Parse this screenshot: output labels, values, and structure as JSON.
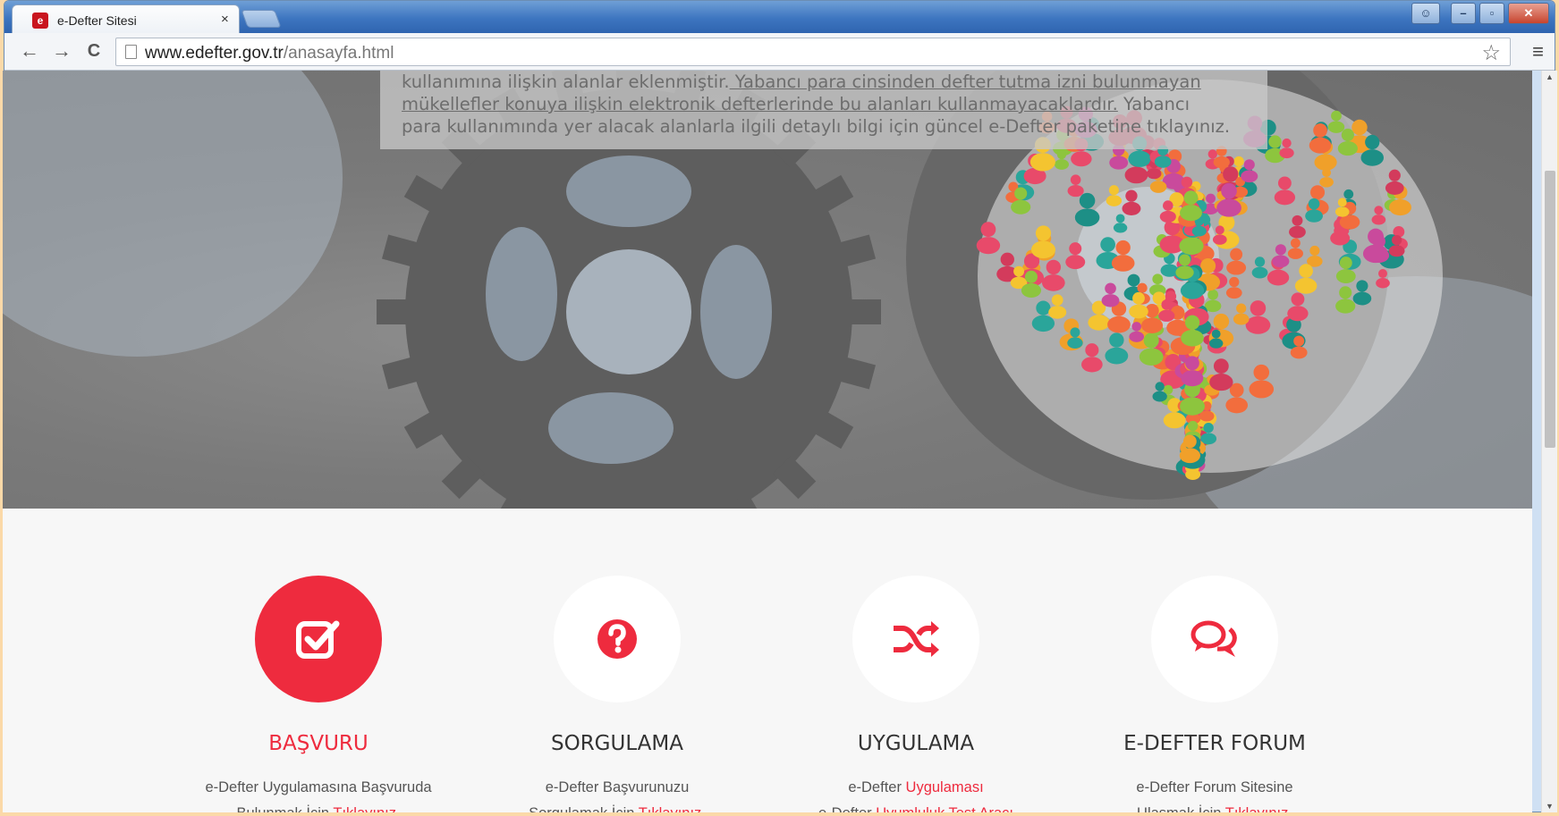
{
  "browser": {
    "tab_title": "e-Defter Sitesi",
    "tab_close": "×",
    "favicon_text": "e",
    "url_domain": "www.edefter.gov.tr",
    "url_path": "/anasayfa.html",
    "back": "←",
    "forward": "→",
    "reload": "C",
    "star": "☆",
    "menu": "≡",
    "win_min": "–",
    "win_max": "▫",
    "win_close": "✕",
    "win_user": "☺"
  },
  "notice": {
    "line1_plain": "kullanımına ilişkin alanlar eklenmiştir.",
    "line1_underlined": " Yabancı para cinsinden defter tutma izni bulunmayan",
    "line2_underlined": "mükellefler konuya ilişkin elektronik defterlerinde bu alanları kullanmayacaklardır.",
    "line2_plain": " Yabancı",
    "line3": "para kullanımında yer alacak alanlarla ilgili detaylı bilgi için güncel e-Defter paketine tıklayınız."
  },
  "features": [
    {
      "title": "BAŞVURU",
      "icon": "checkbox-icon",
      "desc_line1": "e-Defter Uygulamasına Başvuruda",
      "desc_line2_pre": "Bulunmak İçin ",
      "desc_line2_link": "Tıklayınız."
    },
    {
      "title": "SORGULAMA",
      "icon": "question-icon",
      "desc_line1": "e-Defter Başvurunuzu",
      "desc_line2_pre": "Sorgulamak İçin ",
      "desc_line2_link": "Tıklayınız."
    },
    {
      "title": "UYGULAMA",
      "icon": "shuffle-icon",
      "desc_line1_pre": "e-Defter ",
      "desc_line1_link": "Uygulaması",
      "desc_line2_pre": "e-Defter ",
      "desc_line2_link": "Uyumluluk Test Aracı"
    },
    {
      "title": "E-DEFTER FORUM",
      "icon": "chat-icon",
      "desc_line1": "e-Defter Forum Sitesine",
      "desc_line2_pre": "Ulaşmak İçin ",
      "desc_line2_link": "Tıklayınız."
    }
  ],
  "colors": {
    "accent": "#ee2b3e",
    "text": "#333333"
  }
}
